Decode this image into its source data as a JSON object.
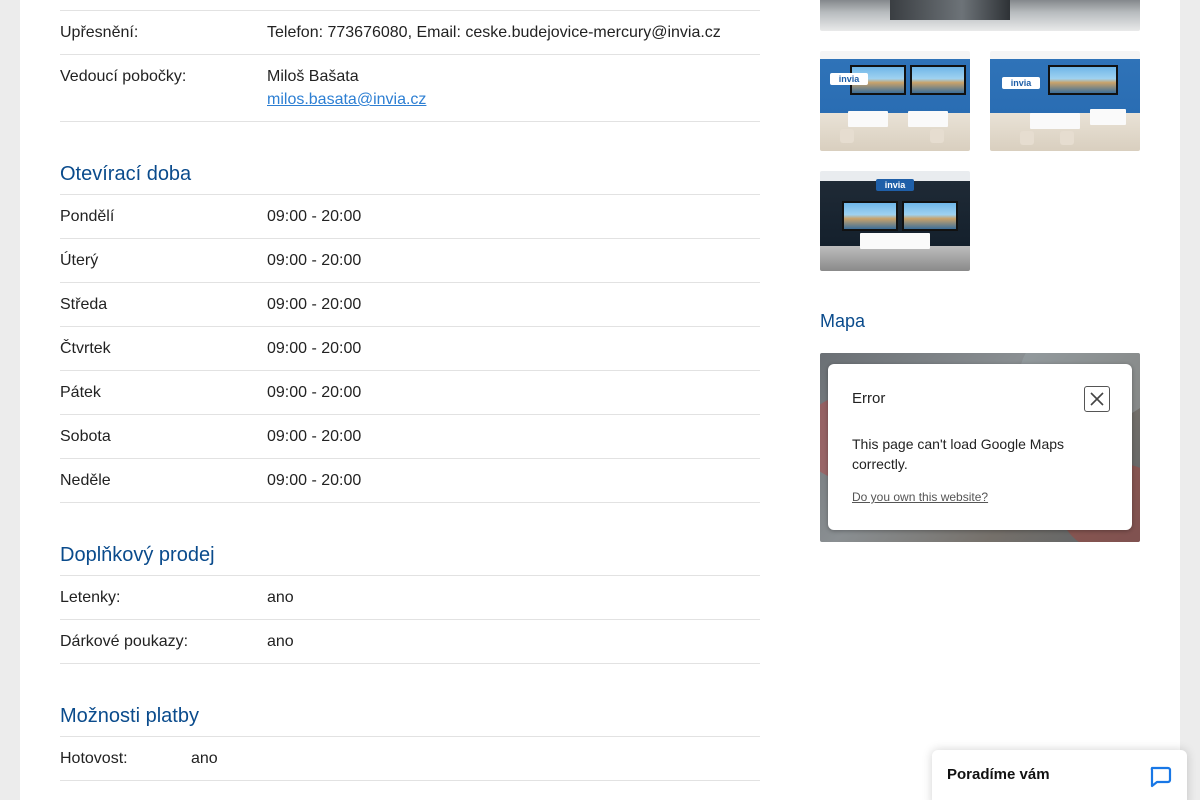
{
  "contact": {
    "upresneni_label": "Upřesnění:",
    "upresneni_value": "Telefon: 773676080, Email: ceske.budejovice-mercury@invia.cz",
    "manager_label": "Vedoucí pobočky:",
    "manager_name": "Miloš Bašata",
    "manager_email": "milos.basata@invia.cz"
  },
  "hours": {
    "title": "Otevírací doba",
    "days": [
      {
        "day": "Pondělí",
        "time": "09:00 - 20:00"
      },
      {
        "day": "Úterý",
        "time": "09:00 - 20:00"
      },
      {
        "day": "Středa",
        "time": "09:00 - 20:00"
      },
      {
        "day": "Čtvrtek",
        "time": "09:00 - 20:00"
      },
      {
        "day": "Pátek",
        "time": "09:00 - 20:00"
      },
      {
        "day": "Sobota",
        "time": "09:00 - 20:00"
      },
      {
        "day": "Neděle",
        "time": "09:00 - 20:00"
      }
    ]
  },
  "extra_sales": {
    "title": "Doplňkový prodej",
    "items": [
      {
        "label": "Letenky:",
        "value": "ano"
      },
      {
        "label": "Dárkové poukazy:",
        "value": "ano"
      }
    ]
  },
  "payment": {
    "title": "Možnosti platby",
    "items": [
      {
        "label": "Hotovost:",
        "value": "ano"
      }
    ]
  },
  "gallery": {
    "logo_text": "invia"
  },
  "map": {
    "title": "Mapa",
    "error_title": "Error",
    "error_message": "This page can't load Google Maps correctly.",
    "error_link": "Do you own this website?"
  },
  "chat": {
    "label": "Poradíme vám"
  },
  "colors": {
    "heading": "#0a4b8c",
    "link": "#2d7fd3",
    "border": "#e2e2e2"
  }
}
